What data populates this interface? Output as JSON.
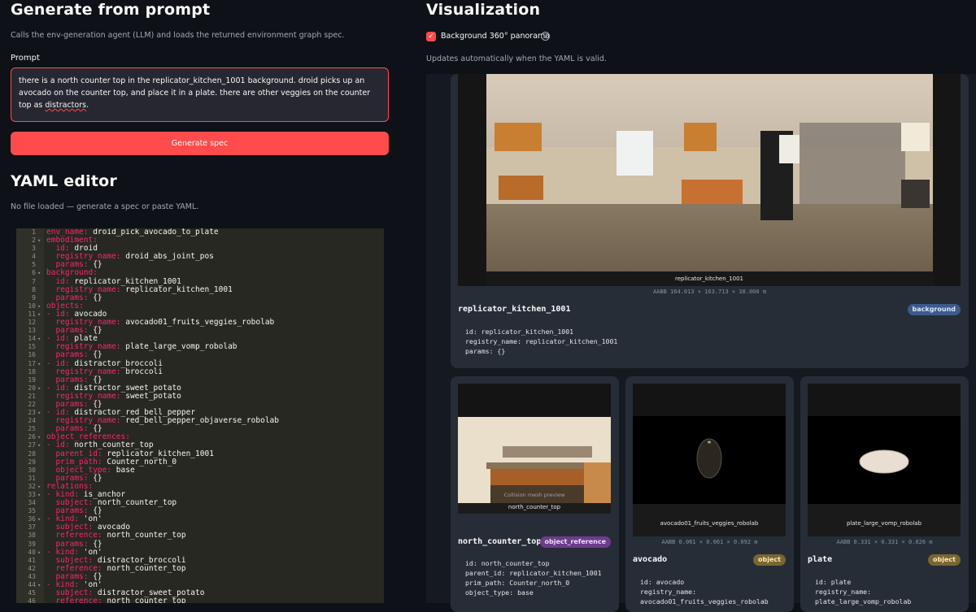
{
  "left": {
    "gen_title": "Generate from prompt",
    "gen_caption": "Calls the env-generation agent (LLM) and loads the returned environment graph spec.",
    "prompt_label": "Prompt",
    "prompt_text_a": "there is a north counter top  in the replicator_kitchen_1001 background. droid picks up an avocado on the counter top, and place it in a plate. there are other veggies on the counter top as ",
    "prompt_text_b": "distractors",
    "prompt_text_c": ".",
    "generate_button": "Generate spec",
    "yaml_title": "YAML editor",
    "yaml_caption": "No file loaded — generate a spec or paste YAML."
  },
  "yaml_lines": [
    {
      "n": "1",
      "f": "",
      "k": "env_name:",
      "v": " droid_pick_avocado_to_plate"
    },
    {
      "n": "2",
      "f": "▾",
      "k": "embodiment:",
      "v": ""
    },
    {
      "n": "3",
      "f": "",
      "k": "  id:",
      "v": " droid"
    },
    {
      "n": "4",
      "f": "",
      "k": "  registry_name:",
      "v": " droid_abs_joint_pos"
    },
    {
      "n": "5",
      "f": "",
      "k": "  params:",
      "v": " {}"
    },
    {
      "n": "6",
      "f": "▾",
      "k": "background:",
      "v": ""
    },
    {
      "n": "7",
      "f": "",
      "k": "  id:",
      "v": " replicator_kitchen_1001"
    },
    {
      "n": "8",
      "f": "",
      "k": "  registry_name:",
      "v": " replicator_kitchen_1001"
    },
    {
      "n": "9",
      "f": "",
      "k": "  params:",
      "v": " {}"
    },
    {
      "n": "10",
      "f": "▾",
      "k": "objects:",
      "v": ""
    },
    {
      "n": "11",
      "f": "▾",
      "k": "- id:",
      "v": " avocado"
    },
    {
      "n": "12",
      "f": "",
      "k": "  registry_name:",
      "v": " avocado01_fruits_veggies_robolab"
    },
    {
      "n": "13",
      "f": "",
      "k": "  params:",
      "v": " {}"
    },
    {
      "n": "14",
      "f": "▾",
      "k": "- id:",
      "v": " plate"
    },
    {
      "n": "15",
      "f": "",
      "k": "  registry_name:",
      "v": " plate_large_vomp_robolab"
    },
    {
      "n": "16",
      "f": "",
      "k": "  params:",
      "v": " {}"
    },
    {
      "n": "17",
      "f": "▾",
      "k": "- id:",
      "v": " distractor_broccoli"
    },
    {
      "n": "18",
      "f": "",
      "k": "  registry_name:",
      "v": " broccoli"
    },
    {
      "n": "19",
      "f": "",
      "k": "  params:",
      "v": " {}"
    },
    {
      "n": "20",
      "f": "▾",
      "k": "- id:",
      "v": " distractor_sweet_potato"
    },
    {
      "n": "21",
      "f": "",
      "k": "  registry_name:",
      "v": " sweet_potato"
    },
    {
      "n": "22",
      "f": "",
      "k": "  params:",
      "v": " {}"
    },
    {
      "n": "23",
      "f": "▾",
      "k": "- id:",
      "v": " distractor_red_bell_pepper"
    },
    {
      "n": "24",
      "f": "",
      "k": "  registry_name:",
      "v": " red_bell_pepper_objaverse_robolab"
    },
    {
      "n": "25",
      "f": "",
      "k": "  params:",
      "v": " {}"
    },
    {
      "n": "26",
      "f": "▾",
      "k": "object_references:",
      "v": ""
    },
    {
      "n": "27",
      "f": "▾",
      "k": "- id:",
      "v": " north_counter_top"
    },
    {
      "n": "28",
      "f": "",
      "k": "  parent_id:",
      "v": " replicator_kitchen_1001"
    },
    {
      "n": "29",
      "f": "",
      "k": "  prim_path:",
      "v": " Counter_north_0"
    },
    {
      "n": "30",
      "f": "",
      "k": "  object_type:",
      "v": " base"
    },
    {
      "n": "31",
      "f": "",
      "k": "  params:",
      "v": " {}"
    },
    {
      "n": "32",
      "f": "▾",
      "k": "relations:",
      "v": ""
    },
    {
      "n": "33",
      "f": "▾",
      "k": "- kind:",
      "v": " is_anchor"
    },
    {
      "n": "34",
      "f": "",
      "k": "  subject:",
      "v": " north_counter_top"
    },
    {
      "n": "35",
      "f": "",
      "k": "  params:",
      "v": " {}"
    },
    {
      "n": "36",
      "f": "▾",
      "k": "- kind:",
      "v": " 'on'"
    },
    {
      "n": "37",
      "f": "",
      "k": "  subject:",
      "v": " avocado"
    },
    {
      "n": "38",
      "f": "",
      "k": "  reference:",
      "v": " north_counter_top"
    },
    {
      "n": "39",
      "f": "",
      "k": "  params:",
      "v": " {}"
    },
    {
      "n": "40",
      "f": "▾",
      "k": "- kind:",
      "v": " 'on'"
    },
    {
      "n": "41",
      "f": "",
      "k": "  subject:",
      "v": " distractor_broccoli"
    },
    {
      "n": "42",
      "f": "",
      "k": "  reference:",
      "v": " north_counter_top"
    },
    {
      "n": "43",
      "f": "",
      "k": "  params:",
      "v": " {}"
    },
    {
      "n": "44",
      "f": "▾",
      "k": "- kind:",
      "v": " 'on'"
    },
    {
      "n": "45",
      "f": "",
      "k": "  subject:",
      "v": " distractor_sweet_potato"
    },
    {
      "n": "46",
      "f": "",
      "k": "  reference:",
      "v": " north_counter_top"
    }
  ],
  "right": {
    "viz_title": "Visualization",
    "checkbox_label": "Background 360° panorama",
    "checkbox_mark": "✓",
    "help_mark": "?",
    "viz_caption": "Updates automatically when the YAML is valid.",
    "bg_card": {
      "img_caption": "replicator_kitchen_1001",
      "aabb": "AABB 164.013 × 163.713 × 38.000 m",
      "title": "replicator_kitchen_1001",
      "badge": "background",
      "body": "id: replicator_kitchen_1001\nregistry_name: replicator_kitchen_1001\nparams: {}"
    },
    "cards": [
      {
        "sub_caption": "Collision mesh preview",
        "img_caption": "north_counter_top",
        "aabb": "",
        "title": "north_counter_top",
        "badge": "object_reference",
        "body": "id: north_counter_top\nparent_id: replicator_kitchen_1001\nprim_path: Counter_north_0\nobject_type: base"
      },
      {
        "sub_caption": "",
        "img_caption": "avocado01_fruits_veggies_robolab",
        "aabb": "AABB 0.061 × 0.061 × 0.092 m",
        "title": "avocado",
        "badge": "object",
        "body": "id: avocado\nregistry_name:\navocado01_fruits_veggies_robolab"
      },
      {
        "sub_caption": "",
        "img_caption": "plate_large_vomp_robolab",
        "aabb": "AABB 0.331 × 0.331 × 0.026 m",
        "title": "plate",
        "badge": "object",
        "body": "id: plate\nregistry_name:\nplate_large_vomp_robolab"
      }
    ],
    "colors": {
      "accent": "#ff4b4b",
      "badge_background": "#3d5a8c",
      "badge_object_reference": "#6b3d8c",
      "badge_object": "#7a6630"
    }
  }
}
